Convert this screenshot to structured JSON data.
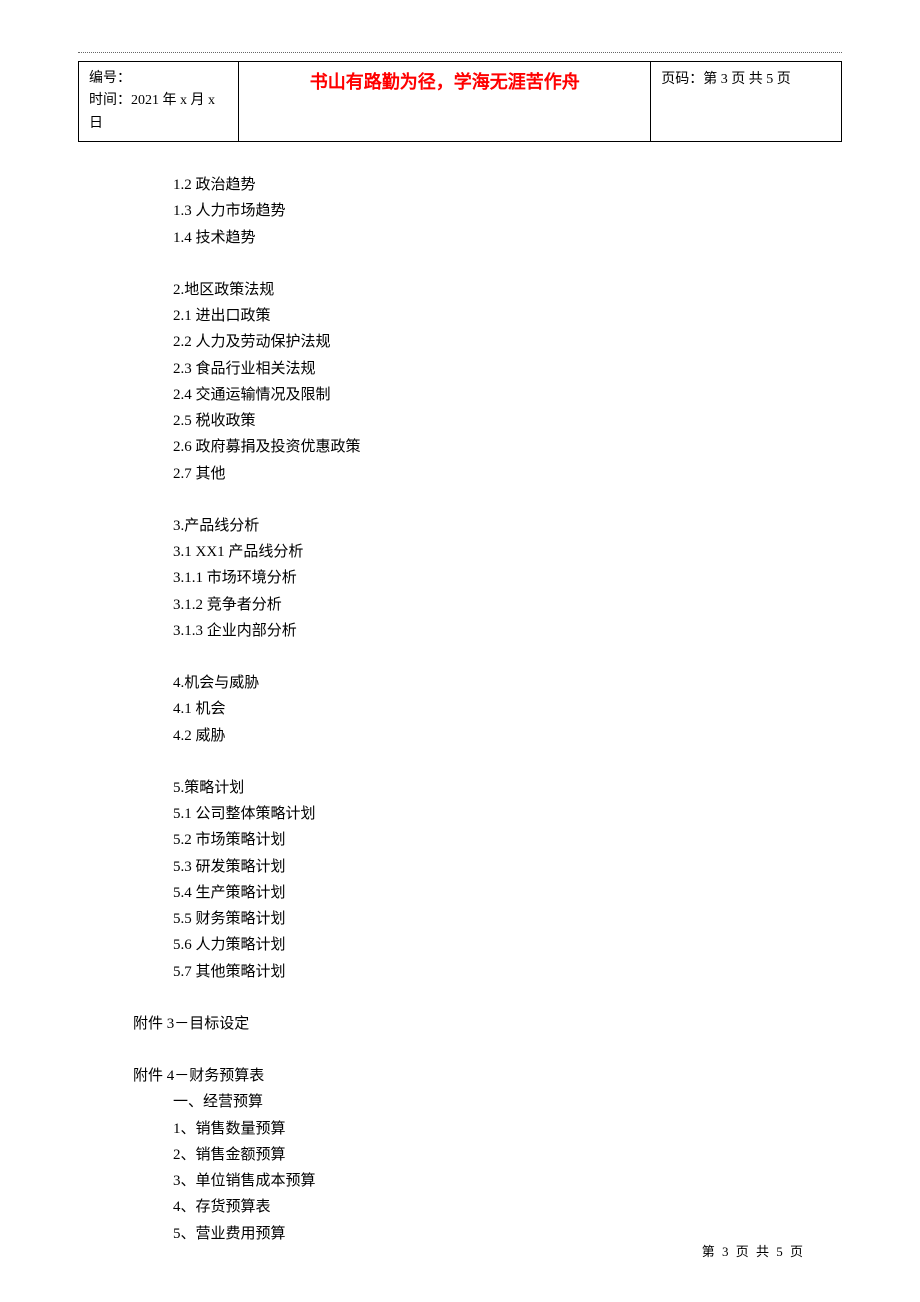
{
  "header": {
    "label_number": "编号：",
    "label_time_prefix": "时间：",
    "time_value": "2021 年 x 月 x 日",
    "center_text": "书山有路勤为径，学海无涯苦作舟",
    "page_label_prefix": "页码：",
    "page_label_value": "第 3 页  共 5 页"
  },
  "sections": {
    "s1": [
      "1.2 政治趋势",
      "1.3 人力市场趋势",
      "1.4 技术趋势"
    ],
    "s2": [
      "2.地区政策法规",
      "2.1 进出口政策",
      "2.2 人力及劳动保护法规",
      "2.3 食品行业相关法规",
      "2.4 交通运输情况及限制",
      "2.5 税收政策",
      "2.6 政府募捐及投资优惠政策",
      "2.7 其他"
    ],
    "s3": [
      "3.产品线分析",
      "3.1 XX1 产品线分析",
      "3.1.1 市场环境分析",
      "3.1.2 竞争者分析",
      "3.1.3 企业内部分析"
    ],
    "s4": [
      "4.机会与威胁",
      "4.1 机会",
      "4.2 威胁"
    ],
    "s5": [
      "5.策略计划",
      "5.1 公司整体策略计划",
      "5.2 市场策略计划",
      "5.3 研发策略计划",
      "5.4 生产策略计划",
      "5.5 财务策略计划",
      "5.6 人力策略计划",
      "5.7 其他策略计划"
    ]
  },
  "attachments": {
    "a3": {
      "title": "附件 3－目标设定"
    },
    "a4": {
      "title": "附件 4－财务预算表",
      "items": [
        "一、经营预算",
        "1、销售数量预算",
        "2、销售金额预算",
        "3、单位销售成本预算",
        "4、存货预算表",
        "5、营业费用预算"
      ]
    }
  },
  "footer": "第  3  页  共  5  页"
}
